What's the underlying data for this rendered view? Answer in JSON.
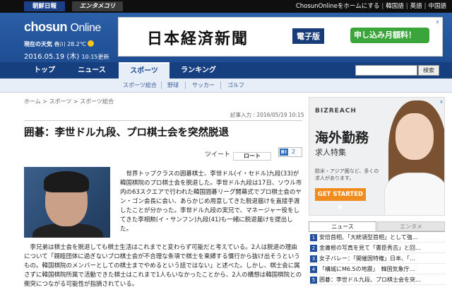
{
  "topbar": {
    "brand1": "朝鮮日報",
    "brand2": "エンタメコリア",
    "links": [
      "ChosunOnlineをホームにする",
      "韓国語",
      "英語",
      "中国語"
    ]
  },
  "header": {
    "logo_main": "chosun",
    "logo_sub": "Online",
    "weather_label": "現在の天気",
    "weather_city": "春川 28.2℃",
    "date": "2016.05.19 (木)",
    "time": "10:15更新"
  },
  "banner_ad": {
    "name": "日本経済新聞",
    "badge": "電子版",
    "cta": "申し込み月額料！",
    "close": "x"
  },
  "nav": {
    "items": [
      "トップ",
      "ニュース",
      "スポーツ",
      "ランキング"
    ],
    "active": "スポーツ",
    "search_button": "検索"
  },
  "subnav": {
    "items": [
      "スポーツ総合",
      "野球",
      "サッカー",
      "ゴルフ"
    ]
  },
  "article": {
    "breadcrumb": "ホーム > スポーツ > スポーツ総合",
    "byline": "記事入力 : 2016/05/19 10:15",
    "headline": "囲碁：李世ドル九段、プロ棋士会を突然脱退",
    "tweet_label": "ツイート",
    "tweet_icon_text": "ロート",
    "hatena_label": "B!",
    "hatena_count": "2",
    "para1": "世界トップクラスの囲碁棋士、李世ドル(イ・セドル)九段(33)が韓国棋院のプロ棋士会を脱退した。李世ドル九段は17日、ソウル市内の63スクエアで行われた韓国囲碁リーグ開幕式でプロ棋士会のヤン・ゴン会長に会い、あらかじめ用意してきた脱退届けを直接手渡したことが分かった。李世ドル九段の実兄で、マネージャー役をしてきた李相勲(イ・サンフン)九段(41)も一緒に脱退届けを提出した。",
    "para2": "李兄弟は棋士会を脱退しても棋士生活はこれまでと変わらず可能だと考えている。2人は脱退の理由について「親睦団体に過ぎないプロ棋士会が不合理な条項で棋士を束縛する慣行から抜け出そうというもの。韓国棋院のメンバーとしての棋士までやめるという話ではない」と述べた。しかし、棋士会に属さずに韓国棋院所属で活動できた棋士はこれまで1人もいなかったことから、2人の構想は韓国棋院との衝突につながる可能性が指摘されている。"
  },
  "side_ad": {
    "brand": "BIZREACH",
    "headline": "海外勤務",
    "subhead": "求人特集",
    "desc": "欧米・アジア圏など、多くの求人があります。",
    "cta": "GET STARTED ▶",
    "close": "x"
  },
  "ranking": {
    "tab_active": "ニュース",
    "tab_inactive": "エンタメ",
    "items": [
      "安倍首相、「大統領型首相」として強…",
      "金庸根の写真を見て「書臣秀吉」と回…",
      "女子バレー：「開催国特権」日本、「…",
      "「構城にM6.5の地震」　韓国気象庁…",
      "囲碁：李世ドル九段、プロ棋士会を突…"
    ]
  }
}
